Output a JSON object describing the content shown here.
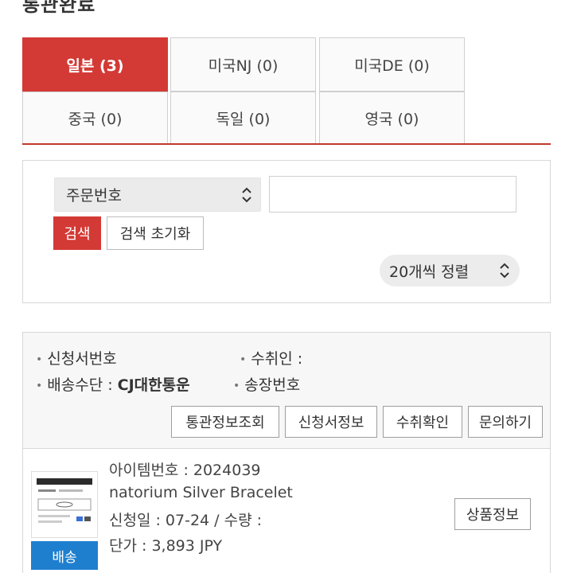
{
  "page": {
    "title": "통관완료"
  },
  "tabs": {
    "row1": [
      {
        "label": "일본 (3)",
        "active": true
      },
      {
        "label": "미국NJ (0)",
        "active": false
      },
      {
        "label": "미국DE (0)",
        "active": false
      }
    ],
    "row2": [
      {
        "label": "중국 (0)",
        "active": false
      },
      {
        "label": "독일 (0)",
        "active": false
      },
      {
        "label": "영국 (0)",
        "active": false
      }
    ]
  },
  "search": {
    "field_select": "주문번호",
    "input_value": "",
    "search_button": "검색",
    "reset_button": "검색 초기화",
    "sort_select": "20개씩 정렬"
  },
  "order": {
    "application_no_label": "신청서번호",
    "recipient_label": "수취인 :",
    "shipping_method_label": "배송수단 :",
    "shipping_method_value": "CJ대한통운",
    "tracking_no_label": "송장번호",
    "actions": [
      "통관정보조회",
      "신청서정보",
      "수취확인",
      "문의하기"
    ]
  },
  "item": {
    "badge": "배송",
    "item_no": "아이템번호 : 2024039",
    "name": "natorium Silver Bracelet",
    "applied": "신청일 : 07-24 / 수량 :",
    "price": "단가 : 3,893 JPY",
    "product_info_button": "상품정보"
  },
  "colors": {
    "accent_red": "#d33a35",
    "badge_blue": "#1f7fcf"
  }
}
